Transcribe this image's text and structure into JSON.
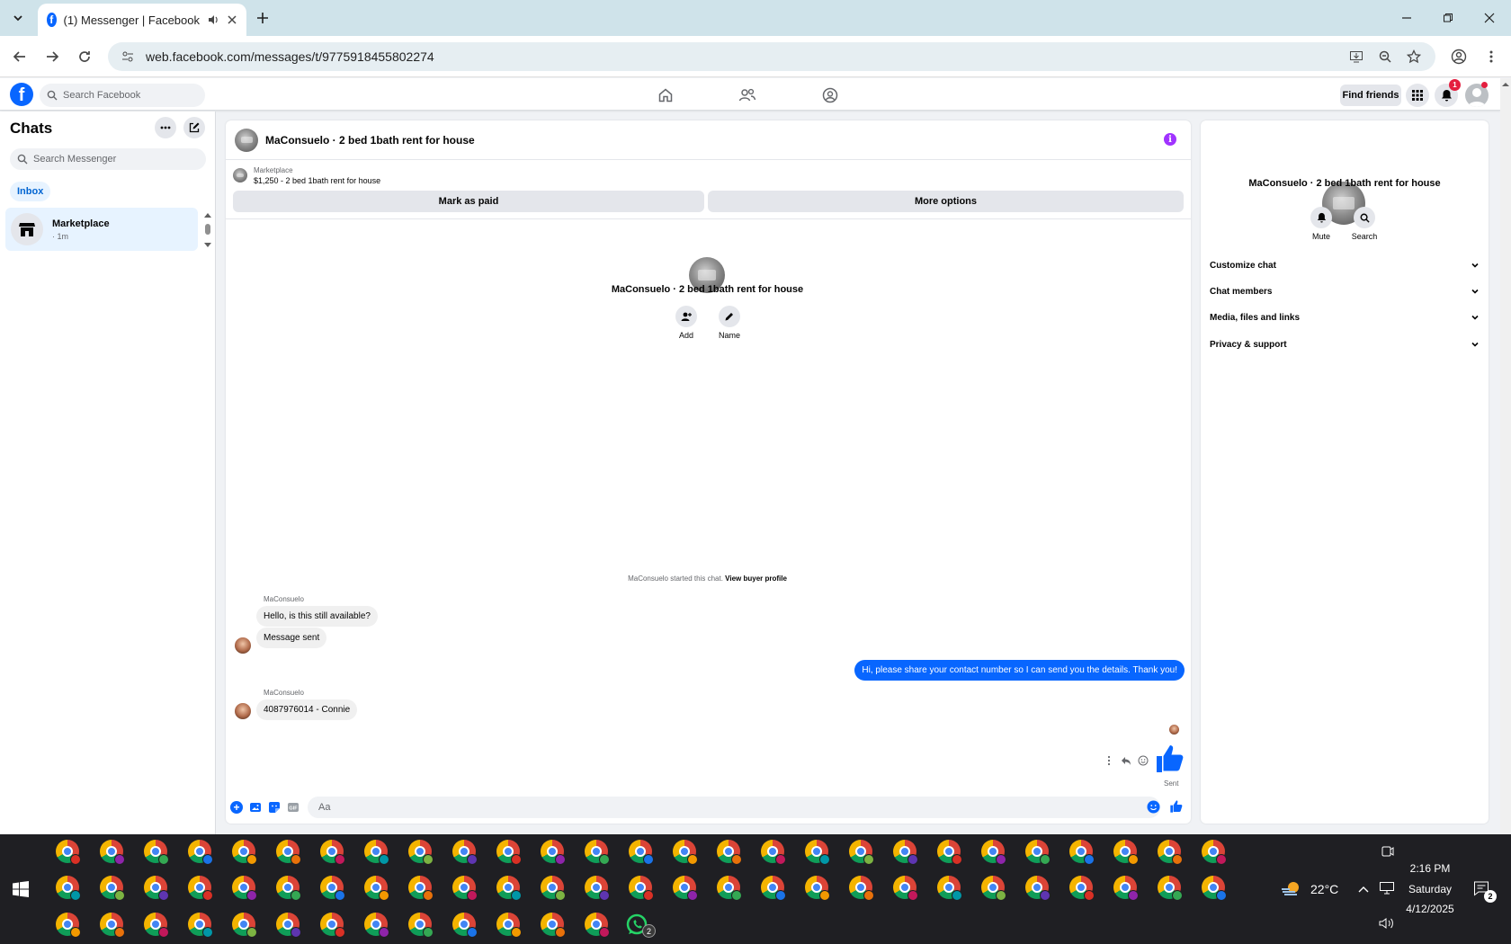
{
  "browser": {
    "tab_title": "(1) Messenger | Facebook",
    "url": "web.facebook.com/messages/t/9775918455802274"
  },
  "fb_header": {
    "search_placeholder": "Search Facebook",
    "find_friends": "Find friends",
    "notification_count": "1"
  },
  "sidebar": {
    "title": "Chats",
    "search_placeholder": "Search Messenger",
    "filter_inbox": "Inbox",
    "conversations": [
      {
        "name": "Marketplace",
        "meta": "· 1m"
      }
    ]
  },
  "chat": {
    "header_title": "MaConsuelo · 2 bed 1bath rent for house",
    "marketplace_label": "Marketplace",
    "listing": "$1,250 - 2 bed 1bath rent for house",
    "mark_as_paid": "Mark as paid",
    "more_options": "More options",
    "profile_name": "MaConsuelo · 2 bed 1bath rent for house",
    "add_label": "Add",
    "name_label": "Name",
    "started_text": "MaConsuelo started this chat.",
    "view_profile": "View buyer profile",
    "messages": [
      {
        "sender": "MaConsuelo",
        "text": "Hello, is this still available?"
      },
      {
        "sender": "",
        "text": "Message sent"
      },
      {
        "sender": "me",
        "text": "Hi, please share your contact number so I can send you the details. Thank you!"
      },
      {
        "sender": "MaConsuelo",
        "text": "4087976014 - Connie"
      }
    ],
    "sent_status": "Sent",
    "composer_placeholder": "Aa"
  },
  "right_panel": {
    "name": "MaConsuelo · 2 bed 1bath rent for house",
    "mute": "Mute",
    "search": "Search",
    "sections": [
      "Customize chat",
      "Chat members",
      "Media, files and links",
      "Privacy & support"
    ]
  },
  "taskbar": {
    "weather": "22°C",
    "time": "2:16 PM",
    "day": "Saturday",
    "date": "4/12/2025",
    "whatsapp_badge": "2",
    "notifications_badge": "2"
  },
  "colors": {
    "accent": "#0866ff",
    "info": "#a033ff",
    "badge": "#e41e3f"
  }
}
